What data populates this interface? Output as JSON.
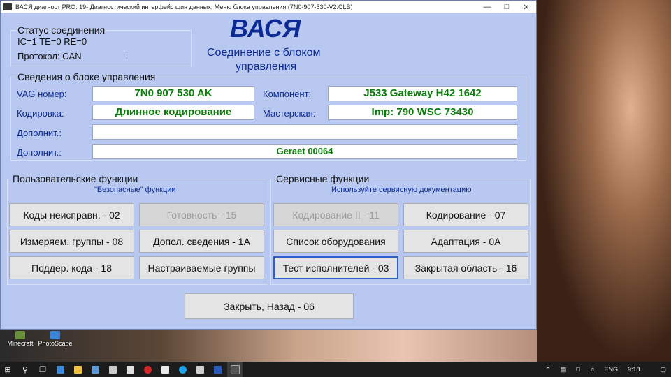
{
  "window": {
    "title": "ВАСЯ диагност PRO: 19- Диагностический интерфейс шин данных,  Меню блока управления (7N0-907-530-V2.CLB)"
  },
  "connection": {
    "group_label": "Статус соединения",
    "counters": "IC=1  TE=0  RE=0",
    "protocol": "Протокол: CAN",
    "cursor": "|"
  },
  "header": {
    "logo": "ВАСЯ",
    "subtitle_line1": "Соединение с блоком",
    "subtitle_line2": "управления"
  },
  "ecu": {
    "group_label": "Сведения о блоке управления",
    "vag_label": "VAG номер:",
    "vag_value": "7N0 907 530 AK",
    "component_label": "Компонент:",
    "component_value": "J533  Gateway H42 1642",
    "coding_label": "Кодировка:",
    "coding_value": "Длинное кодирование",
    "workshop_label": "Мастерская:",
    "workshop_value": "Imp: 790     WSC 73430",
    "extra1_label": "Дополнит.:",
    "extra1_value": "",
    "extra2_label": "Дополнит.:",
    "extra2_value": "Geraet 00064"
  },
  "user_functions": {
    "group_label": "Пользовательские функции",
    "subtitle": "\"Безопасные\" функции",
    "buttons": [
      "Коды неисправн. - 02",
      "Готовность - 15",
      "Измеряем. группы - 08",
      "Допол. сведения - 1А",
      "Поддер. кода - 18",
      "Настраиваемые группы"
    ]
  },
  "service_functions": {
    "group_label": "Сервисные функции",
    "subtitle": "Используйте сервисную документацию",
    "buttons": [
      "Кодирование II - 11",
      "Кодирование - 07",
      "Список оборудования",
      "Адаптация - 0А",
      "Тест исполнителей - 03",
      "Закрытая область - 16"
    ]
  },
  "close_button": "Закрыть, Назад - 06",
  "desktop": {
    "icon1": "Minecraft",
    "icon2": "PhotoScape"
  },
  "taskbar": {
    "lang": "ENG",
    "time": "9:18"
  }
}
